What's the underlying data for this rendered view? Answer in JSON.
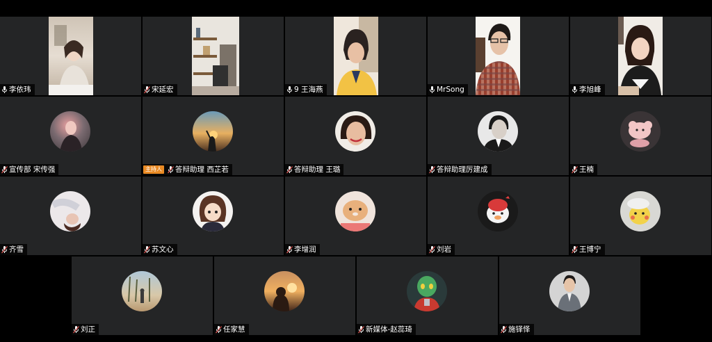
{
  "participants": [
    {
      "name": "李依玮",
      "mic": "on",
      "video": true
    },
    {
      "name": "宋延宏",
      "mic": "muted",
      "video": true
    },
    {
      "name": "9 王海燕",
      "mic": "on",
      "video": true
    },
    {
      "name": "MrSong",
      "mic": "on",
      "video": true
    },
    {
      "name": "李旭峰",
      "mic": "on",
      "video": true
    },
    {
      "name": "宣传部 宋传强",
      "mic": "muted",
      "video": false
    },
    {
      "name": "答辩助理 西芷若",
      "mic": "muted",
      "video": false,
      "badge": "主持人"
    },
    {
      "name": "答辩助理 王璐",
      "mic": "muted",
      "video": false
    },
    {
      "name": "答辩助理厉建成",
      "mic": "muted",
      "video": false
    },
    {
      "name": "王楠",
      "mic": "muted",
      "video": false
    },
    {
      "name": "齐雪",
      "mic": "muted",
      "video": false
    },
    {
      "name": "苏文心",
      "mic": "muted",
      "video": false
    },
    {
      "name": "李增润",
      "mic": "muted",
      "video": false
    },
    {
      "name": "刘岩",
      "mic": "muted",
      "video": false
    },
    {
      "name": "王博宁",
      "mic": "muted",
      "video": false
    },
    {
      "name": "刘正",
      "mic": "muted",
      "video": false
    },
    {
      "name": "任家慧",
      "mic": "muted",
      "video": false
    },
    {
      "name": "新媒体-赵蕊琦",
      "mic": "muted",
      "video": false
    },
    {
      "name": "施铎怿",
      "mic": "muted",
      "video": false
    }
  ],
  "colors": {
    "tile_bg": "#242526",
    "host_badge": "#e98a24",
    "muted_mic": "#d9534f"
  }
}
